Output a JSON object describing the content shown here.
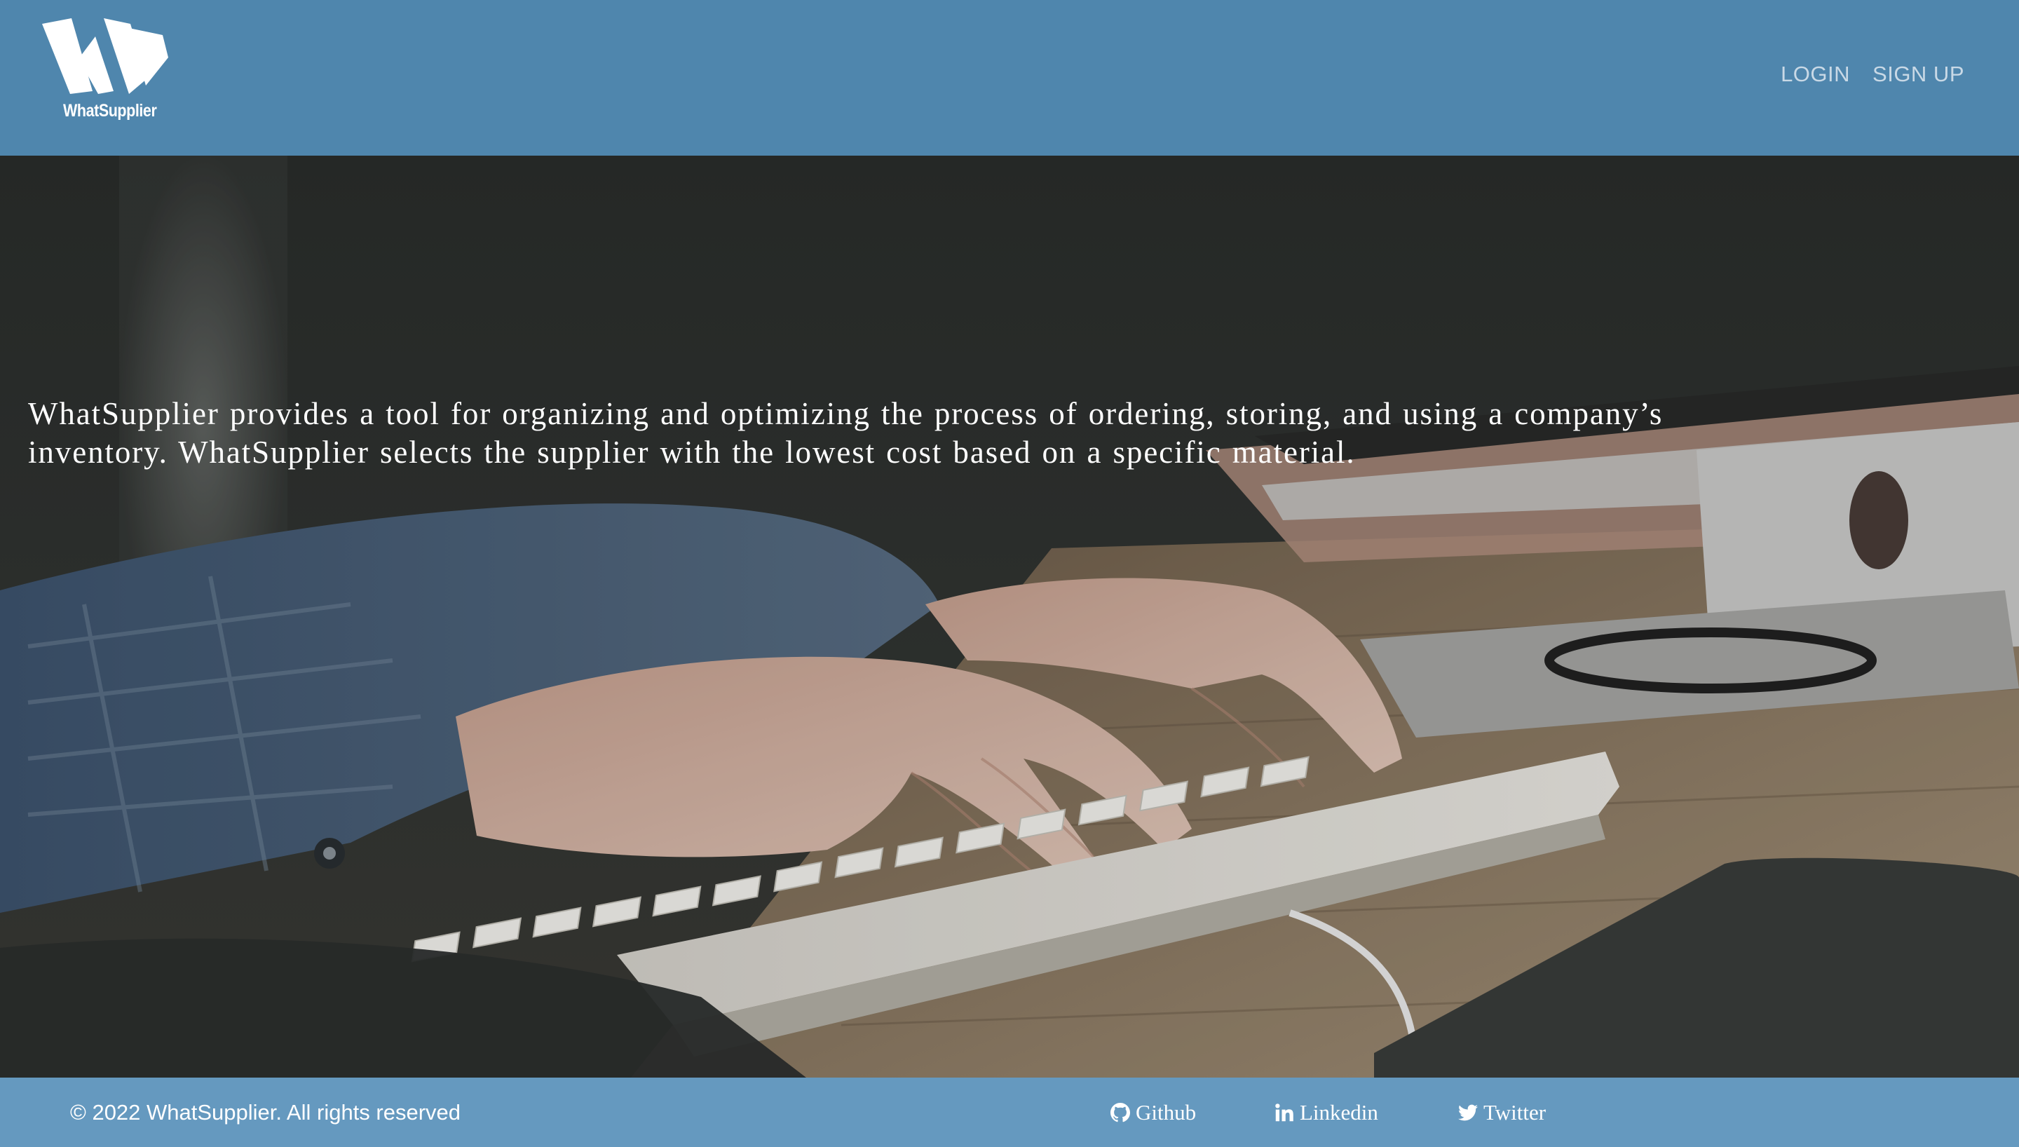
{
  "header": {
    "logo_text": "WhatSupplier",
    "nav": {
      "login": "LOGIN",
      "signup": "SIGN UP"
    }
  },
  "hero": {
    "description": "WhatSupplier provides a tool for organizing and optimizing the process of ordering, storing, and using a company’s inventory. WhatSupplier selects the supplier with the lowest cost based on a specific material."
  },
  "footer": {
    "copyright": "© 2022 WhatSupplier. All rights reserved",
    "links": {
      "github": "Github",
      "linkedin": "Linkedin",
      "twitter": "Twitter"
    }
  },
  "icons": {
    "logo": "w-logo-icon",
    "github": "github-icon",
    "linkedin": "linkedin-icon",
    "twitter": "twitter-icon"
  },
  "colors": {
    "header_bg": "#4f86ad",
    "footer_bg": "#6599bf",
    "nav_text": "#c9d9e6",
    "text": "#ffffff"
  }
}
